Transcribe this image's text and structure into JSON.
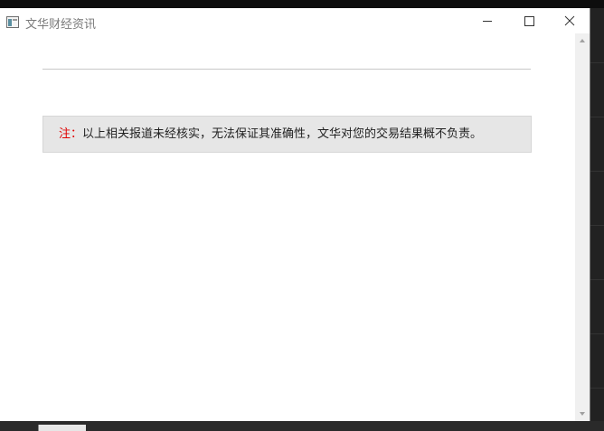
{
  "window": {
    "title": "文华财经资讯",
    "icons": {
      "app": "app-window-icon",
      "minimize": "minimize-icon",
      "maximize": "maximize-icon",
      "close": "close-icon"
    }
  },
  "notice": {
    "prefix": "注：",
    "text": "以上相关报道未经核实，无法保证其准确性，文华对您的交易结果概不负责。"
  },
  "scrollbar": {
    "icons": {
      "up": "scroll-up-arrow-icon",
      "down": "scroll-down-arrow-icon"
    }
  },
  "colors": {
    "notice_prefix": "#e00000",
    "notice_background": "#e6e6e6",
    "title_text": "#7a7a7a"
  }
}
